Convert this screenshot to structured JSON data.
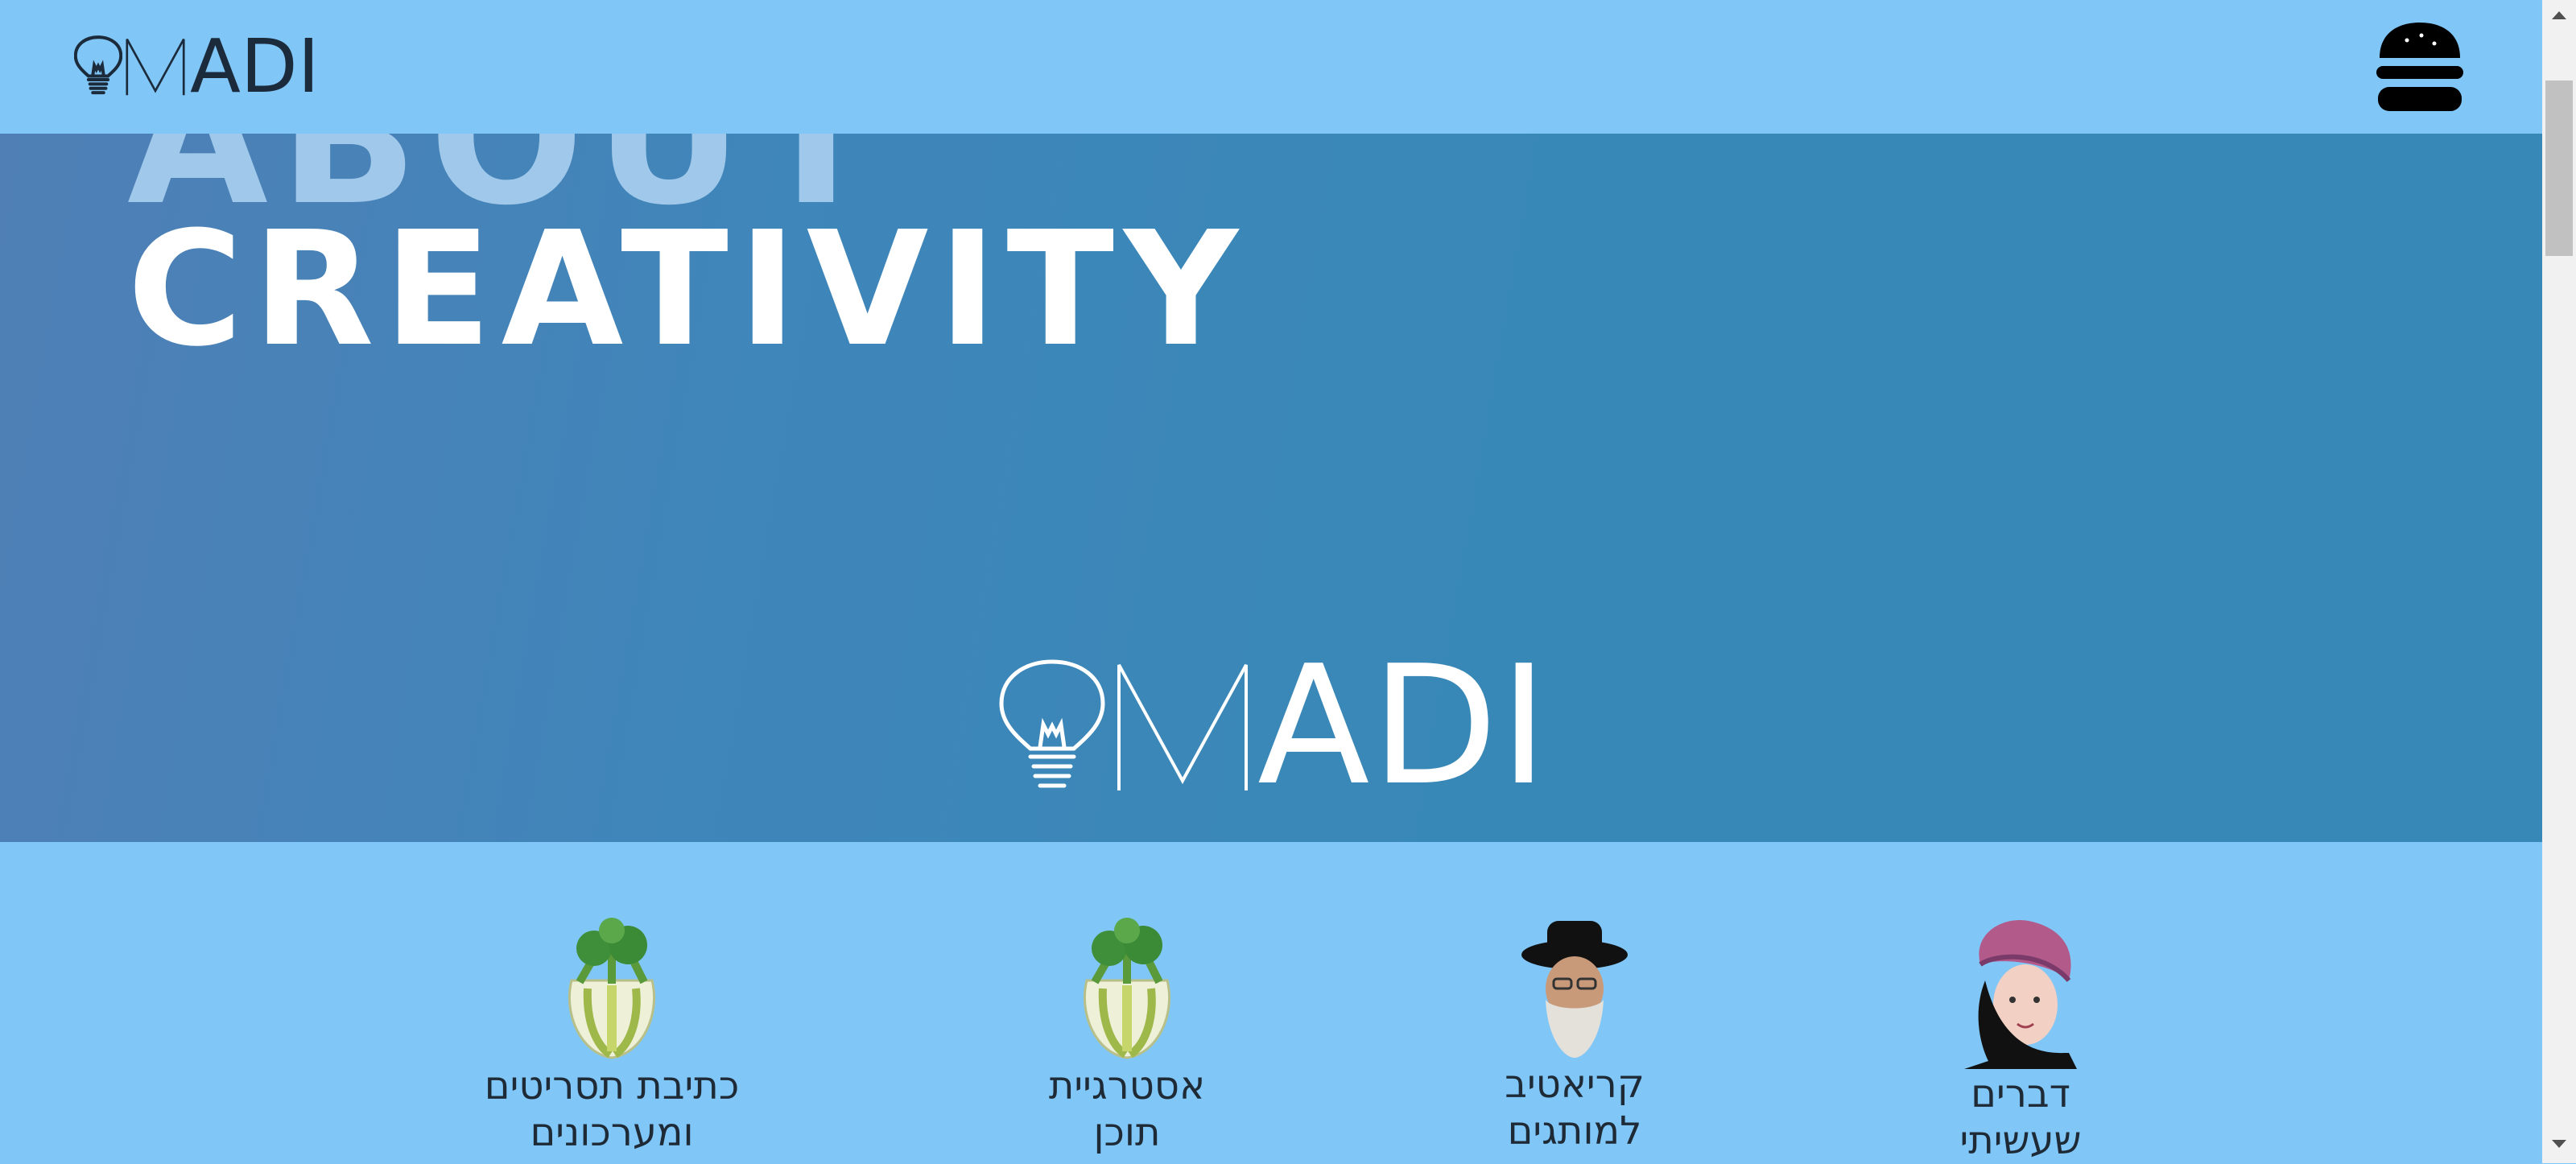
{
  "brand": {
    "letter_m": "M",
    "letters_adi": "ADI"
  },
  "hero": {
    "ghost_text": "ABOUT",
    "title": "CREATIVITY"
  },
  "categories": [
    {
      "label": "כתיבת תסריטים\nומערכונים",
      "icon": "fennel-icon"
    },
    {
      "label": "אסטרגיית\nתוכן",
      "icon": "fennel-icon"
    },
    {
      "label": "קריאטיב\nלמותגים",
      "icon": "rabbi-avatar"
    },
    {
      "label": "דברים\nשעשיתי",
      "icon": "woman-avatar"
    }
  ],
  "colors": {
    "page_bg": "#80c6f7",
    "hero_bg": "#3888b7",
    "text_dark": "#1b2b3b",
    "white": "#ffffff"
  }
}
